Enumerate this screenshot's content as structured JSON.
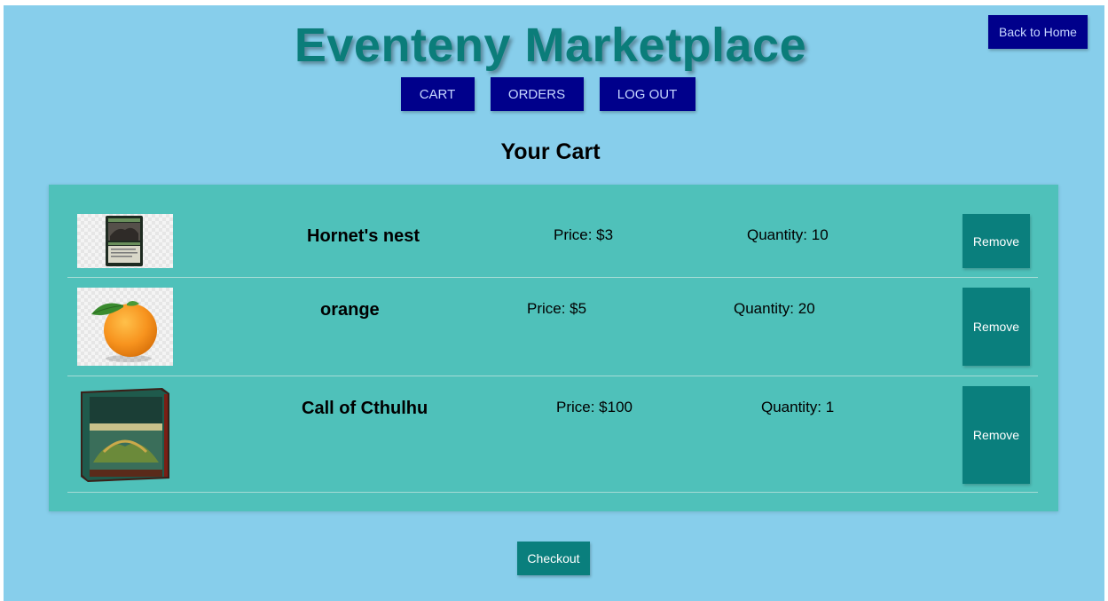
{
  "header": {
    "back_label": "Back to Home",
    "title": "Eventeny Marketplace",
    "nav": {
      "cart": "CART",
      "orders": "ORDERS",
      "logout": "LOG OUT"
    }
  },
  "cart": {
    "heading": "Your Cart",
    "items": [
      {
        "name": "Hornet's nest",
        "price": "Price: $3",
        "quantity": "Quantity: 10",
        "remove_label": "Remove",
        "image": "trading-card-image"
      },
      {
        "name": "orange",
        "price": "Price: $5",
        "quantity": "Quantity: 20",
        "remove_label": "Remove",
        "image": "orange-fruit-image"
      },
      {
        "name": "Call of Cthulhu",
        "price": "Price: $100",
        "quantity": "Quantity: 1",
        "remove_label": "Remove",
        "image": "card-game-box-image"
      }
    ]
  },
  "footer": {
    "checkout_label": "Checkout"
  },
  "colors": {
    "page_bg": "#87ceeb",
    "panel_bg": "#4fc1ba",
    "nav_button": "#00008b",
    "action_button": "#0a7f7d",
    "title": "#0b7d7a"
  }
}
